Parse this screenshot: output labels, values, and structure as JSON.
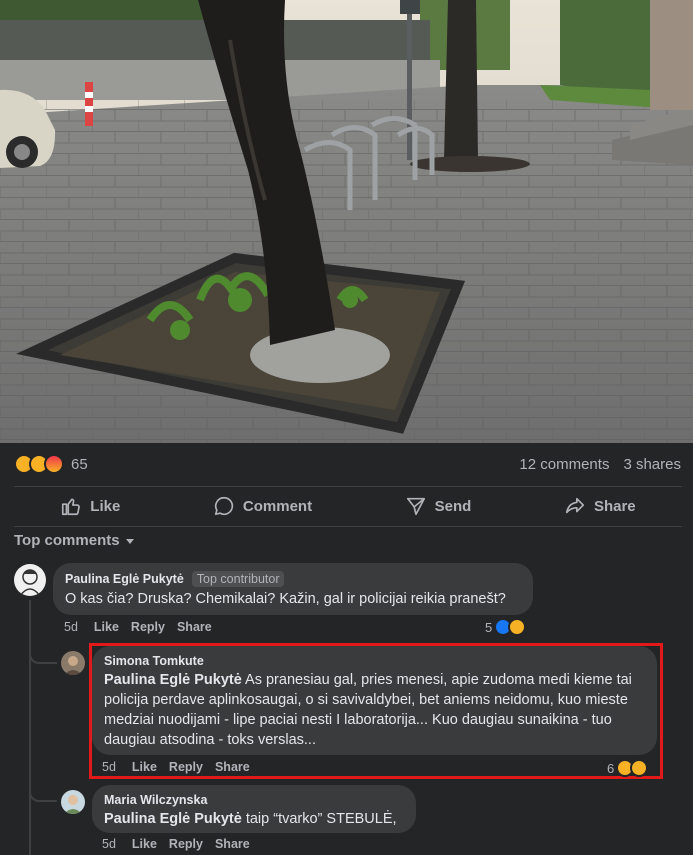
{
  "post": {
    "reactions": {
      "icons": [
        "wow",
        "sad",
        "angry"
      ],
      "count": "65"
    },
    "stats": {
      "comments": "12 comments",
      "shares": "3 shares"
    }
  },
  "actions": {
    "like": "Like",
    "comment": "Comment",
    "send": "Send",
    "share": "Share"
  },
  "top_comments_label": "Top comments",
  "comments": [
    {
      "author": "Paulina Eglė Pukytė",
      "badge": "Top contributor",
      "text": "O kas čia? Druska? Chemikalai? Kažin, gal ir policijai reikia pranešt?",
      "time": "5d",
      "like": "Like",
      "reply": "Reply",
      "share": "Share",
      "reaction_count": "5"
    },
    {
      "author": "Simona Tomkute",
      "mention": "Paulina Eglė Pukytė",
      "text": " As pranesiau gal, pries menesi, apie zudoma medi kieme tai policija perdave aplinkosaugai, o si savivaldybei, bet aniems neidomu, kuo mieste medziai nuodijami - lipe paciai nesti I laboratorija... Kuo daugiau sunaikina - tuo daugiau atsodina - toks verslas...",
      "time": "5d",
      "like": "Like",
      "reply": "Reply",
      "share": "Share",
      "reaction_count": "6"
    },
    {
      "author": "Maria Wilczynska",
      "mention": "Paulina Eglė Pukytė",
      "text": " taip “tvarko” STEBULĖ,",
      "time": "5d",
      "like": "Like",
      "reply": "Reply",
      "share": "Share"
    }
  ],
  "colors": {
    "background": "#242526",
    "bubble": "#3a3b3c",
    "text": "#e4e6eb",
    "muted": "#b0b3b8",
    "highlight": "#e11919",
    "like_blue": "#1877f2",
    "emoji_yellow": "#f7b125"
  }
}
